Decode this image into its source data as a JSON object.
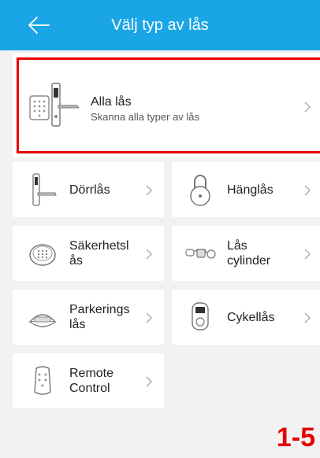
{
  "header": {
    "title": "Välj typ av lås",
    "back_icon": "arrow-left-icon"
  },
  "all_locks": {
    "title": "Alla lås",
    "subtitle": "Skanna alla typer av lås",
    "icon": "smart-door-lock-icon"
  },
  "lock_types": [
    {
      "label": "Dörrlås",
      "icon": "door-lock-icon"
    },
    {
      "label": "Hänglås",
      "icon": "padlock-icon"
    },
    {
      "label": "Säkerhetsl\nås",
      "icon": "safe-lock-icon"
    },
    {
      "label": "Lås\ncylinder",
      "icon": "lock-cylinder-icon"
    },
    {
      "label": "Parkerings\nlås",
      "icon": "parking-lock-icon"
    },
    {
      "label": "Cykellås",
      "icon": "bike-lock-icon"
    },
    {
      "label": "Remote\nControl",
      "icon": "remote-control-icon"
    }
  ],
  "overlay_label": "1-5",
  "colors": {
    "header": "#1aa6e6",
    "highlight": "#e60000",
    "background": "#f2f2f2"
  }
}
